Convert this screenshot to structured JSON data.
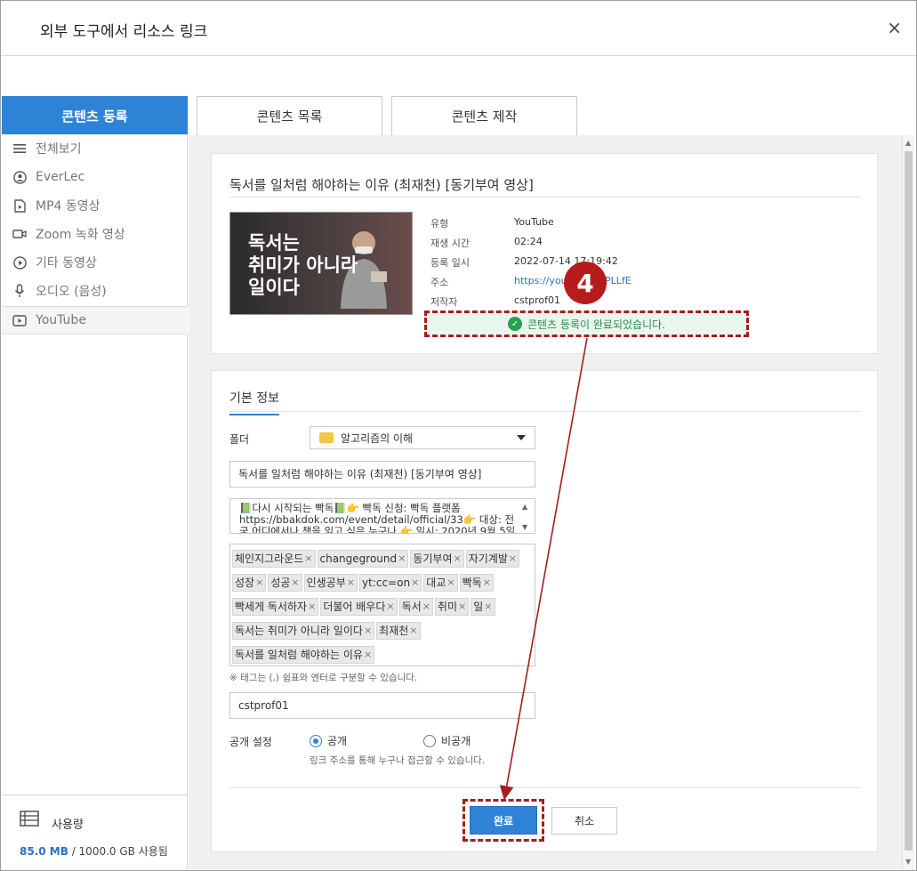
{
  "window": {
    "title": "외부 도구에서 리소스 링크",
    "close_symbol": "×"
  },
  "tabs": [
    {
      "label": "콘텐츠 등록",
      "active": true
    },
    {
      "label": "콘텐츠 목록",
      "active": false
    },
    {
      "label": "콘텐츠 제작",
      "active": false
    }
  ],
  "sidebar": {
    "items": [
      {
        "label": "전체보기",
        "icon": "list-icon"
      },
      {
        "label": "EverLec",
        "icon": "everlec-icon"
      },
      {
        "label": "MP4 동영상",
        "icon": "mp4-file-icon"
      },
      {
        "label": "Zoom 녹화 영상",
        "icon": "camera-icon"
      },
      {
        "label": "기타 동영상",
        "icon": "play-circle-icon"
      },
      {
        "label": "오디오 (음성)",
        "icon": "microphone-icon"
      },
      {
        "label": "YouTube",
        "icon": "youtube-icon",
        "selected": true
      }
    ],
    "usage": {
      "label": "사용량",
      "used": "85.0 MB",
      "rest": " / 1000.0 GB 사용됨"
    }
  },
  "video": {
    "title": "독서를 일처럼 해야하는 이유 (최재천) [동기부여 영상]",
    "thumbnail_text_1": "독서는",
    "thumbnail_text_2": "취미가 아니라",
    "thumbnail_text_3": "일이다",
    "meta": [
      {
        "label": "유형",
        "value": "YouTube"
      },
      {
        "label": "재생 시간",
        "value": "02:24"
      },
      {
        "label": "등록 일시",
        "value": "2022-07-14 17:19:42"
      },
      {
        "label": "주소",
        "value": "https://you...DNxOPLLfE"
      },
      {
        "label": "저작자",
        "value": "cstprof01"
      }
    ]
  },
  "success_message": "콘텐츠 등록이 완료되었습니다.",
  "step_badge": "4",
  "form": {
    "section_tab": "기본 정보",
    "folder_label": "폴더",
    "folder_value": "알고리즘의 이해",
    "title_value": "독서를 일처럼 해야하는 이유 (최재천) [동기부여 영상]",
    "description_value": "📗다시 시작되는 빡독📗👉 빡독 신청: 빡독 플랫폼https://bbakdok.com/event/detail/official/33👉 대상: 전국 어디에서나 책을 읽고 싶은 누구나 👉 일시: 2020년 9월 5일",
    "tag_rows": [
      [
        "체인지그라운드",
        "changeground",
        "동기부여",
        "자기계발"
      ],
      [
        "성장",
        "성공",
        "인생공부",
        "yt:cc=on",
        "대교",
        "빡독"
      ],
      [
        "빡세게 독서하자",
        "더불어 배우다",
        "독서",
        "취미",
        "일"
      ],
      [
        "독서는 취미가 아니라 일이다",
        "최재천"
      ],
      [
        "독서를 일처럼 해야하는 이유"
      ]
    ],
    "tag_remove": "×",
    "tag_hint": "※ 태그는 (,) 쉼표와 엔터로 구분할 수 있습니다.",
    "author_value": "cstprof01",
    "visibility_label": "공개 설정",
    "visibility_public": "공개",
    "visibility_private": "비공개",
    "visibility_selected": "공개",
    "visibility_hint": "링크 주소를 통해 누구나 접근할 수 있습니다."
  },
  "buttons": {
    "done": "완료",
    "cancel": "취소"
  },
  "colors": {
    "accent": "#2e83d6",
    "annotation": "#a51d1d",
    "success_bg": "#e9f6ee",
    "success_text": "#2c8a4d"
  }
}
